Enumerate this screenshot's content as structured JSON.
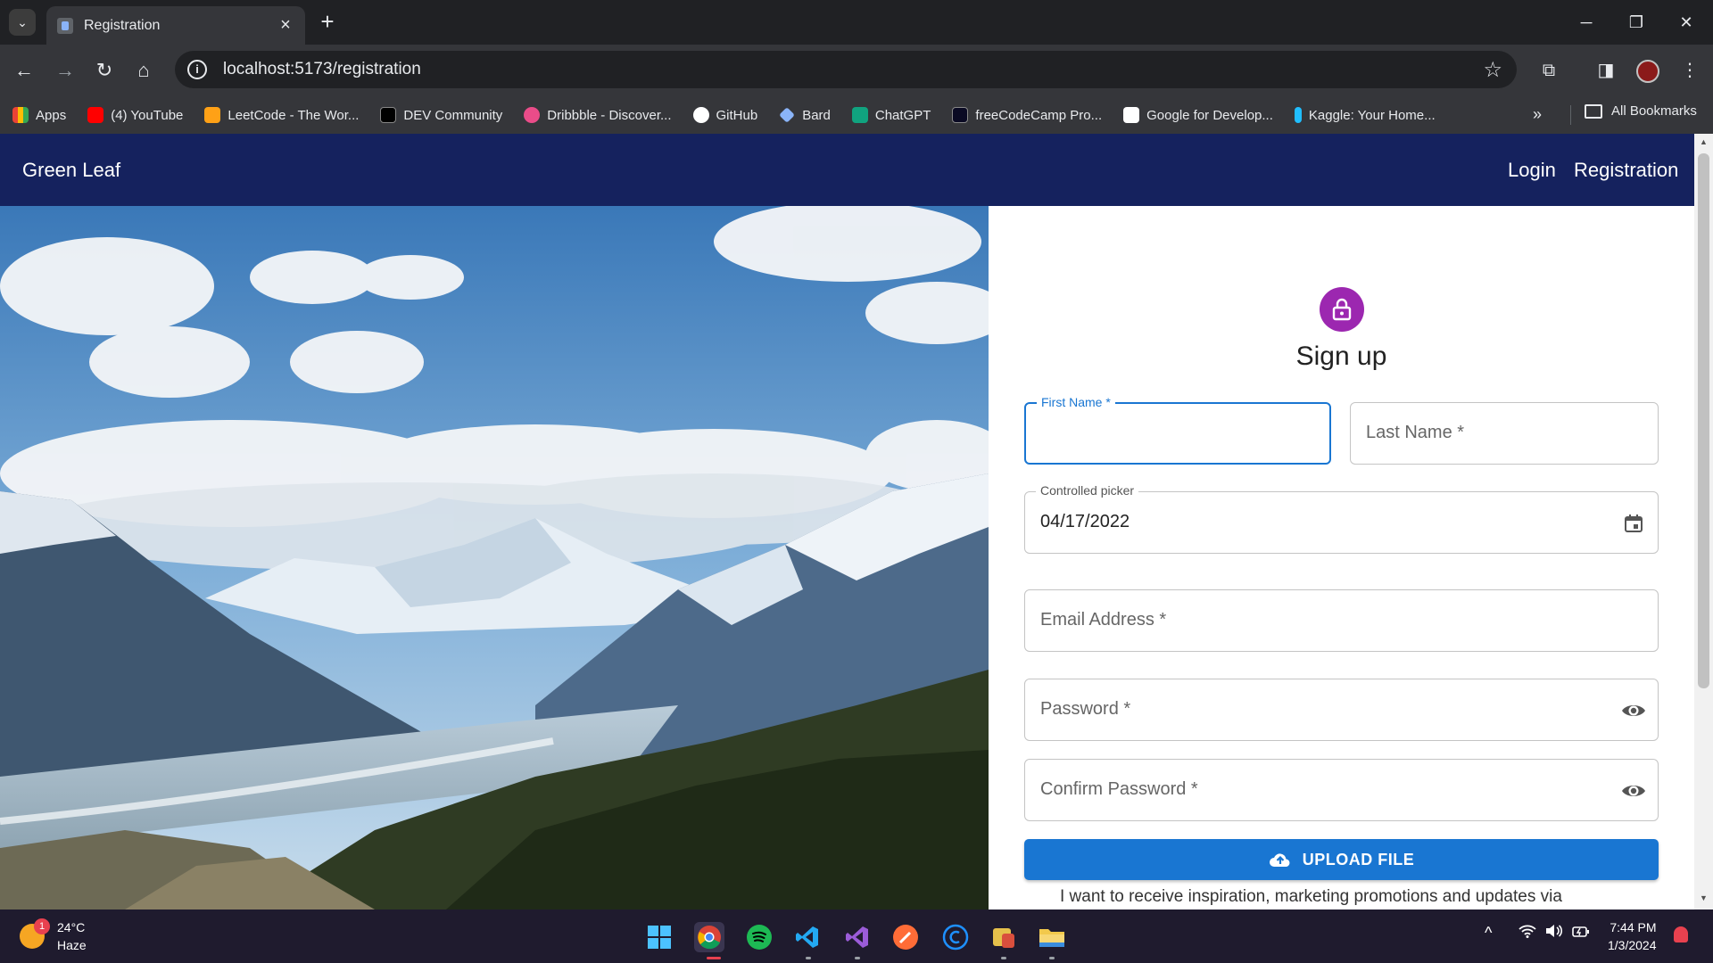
{
  "browser": {
    "tab_title": "Registration",
    "url": "localhost:5173/registration",
    "bookmarks": [
      {
        "label": "Apps",
        "color": "#4285f4"
      },
      {
        "label": "(4) YouTube",
        "color": "#ff0000"
      },
      {
        "label": "LeetCode - The Wor...",
        "color": "#ffa116"
      },
      {
        "label": "DEV Community",
        "color": "#000000"
      },
      {
        "label": "Dribbble - Discover...",
        "color": "#ea4c89"
      },
      {
        "label": "GitHub",
        "color": "#ffffff"
      },
      {
        "label": "Bard",
        "color": "#8ab4f8"
      },
      {
        "label": "ChatGPT",
        "color": "#10a37f"
      },
      {
        "label": "freeCodeCamp Pro...",
        "color": "#0a0a23"
      },
      {
        "label": "Google for Develop...",
        "color": "#ffffff"
      },
      {
        "label": "Kaggle: Your Home...",
        "color": "#20beff"
      }
    ],
    "all_bookmarks": "All Bookmarks"
  },
  "app": {
    "brand": "Green Leaf",
    "nav": {
      "login": "Login",
      "registration": "Registration"
    }
  },
  "form": {
    "heading": "Sign up",
    "first_name_label": "First Name *",
    "last_name_label": "Last Name *",
    "date_label": "Controlled picker",
    "date_value": "04/17/2022",
    "email_label": "Email Address *",
    "password_label": "Password *",
    "confirm_password_label": "Confirm Password *",
    "upload_label": "UPLOAD FILE",
    "consent_text": "I want to receive inspiration, marketing promotions and updates via"
  },
  "taskbar": {
    "weather_temp": "24°C",
    "weather_desc": "Haze",
    "notification_count": "1",
    "time": "7:44 PM",
    "date": "1/3/2024"
  },
  "colors": {
    "appbar": "#15225e",
    "primary": "#1976d2",
    "avatar": "#9c27b0"
  }
}
